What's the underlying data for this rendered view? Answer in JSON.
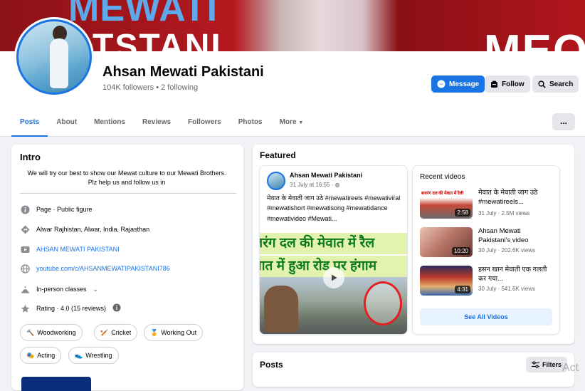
{
  "cover": {
    "text1": "MEWATI",
    "text2": "TSTANI",
    "text3": "MEO"
  },
  "profile": {
    "name": "Ahsan Mewati Pakistani",
    "followers": "104K followers • 2 following"
  },
  "actions": {
    "message": "Message",
    "follow": "Follow",
    "search": "Search",
    "more": "..."
  },
  "tabs": [
    "Posts",
    "About",
    "Mentions",
    "Reviews",
    "Followers",
    "Photos",
    "More"
  ],
  "intro": {
    "title": "Intro",
    "bio": "We will try our best to show our Mewat culture to our Mewati Brothers. Plz help us and follow us in",
    "rows": [
      {
        "icon": "info-icon",
        "text": "Page · Public figure"
      },
      {
        "icon": "location-icon",
        "text": "Alwar Rajhistan, Alwar, India, Rajasthan"
      },
      {
        "icon": "youtube-icon",
        "text": "AHSAN MEWATI PAKISTANI"
      },
      {
        "icon": "globe-icon",
        "text": "youtube.com/c/AHSANMEWATIPAKISTANI786"
      },
      {
        "icon": "class-icon",
        "text": "In-person classes"
      },
      {
        "icon": "star-icon",
        "text": "Rating · 4.0 (15 reviews)"
      }
    ],
    "interests": [
      "Woodworking",
      "Cricket",
      "Working Out",
      "Acting",
      "Wrestling"
    ]
  },
  "featured": {
    "title": "Featured",
    "post": {
      "author": "Ahsan Mewati Pakistani",
      "date": "31 July at 16:55 ·",
      "text": "मेवात के मेवाती जाग उठे #mewatireels #mewativiral #mewatishort #mewatisong #mewatidance #mewativideo #Mewati...",
      "image_line1": "जरंग दल की मेवात में रैल",
      "image_line2": "वात में हुआ रोड पर हंगाम"
    },
    "recent": {
      "title": "Recent videos",
      "videos": [
        {
          "title": "मेवात के मेवाती जाग उठे #mewatireels...",
          "meta": "31 July · 2.5M views",
          "duration": "2:58"
        },
        {
          "title": "Ahsan Mewati Pakistani's video",
          "meta": "30 July · 202.6K views",
          "duration": "10:20"
        },
        {
          "title": "हसन खान मेवाती एक गलती कर गया...",
          "meta": "30 July · 541.6K views",
          "duration": "4:31"
        }
      ],
      "see_all": "See All Videos"
    }
  },
  "posts": {
    "title": "Posts",
    "filters": "Filters"
  },
  "watermark": "Act",
  "colors": {
    "accent": "#1b74e4",
    "background": "#f0f2f5",
    "card": "#ffffff"
  }
}
